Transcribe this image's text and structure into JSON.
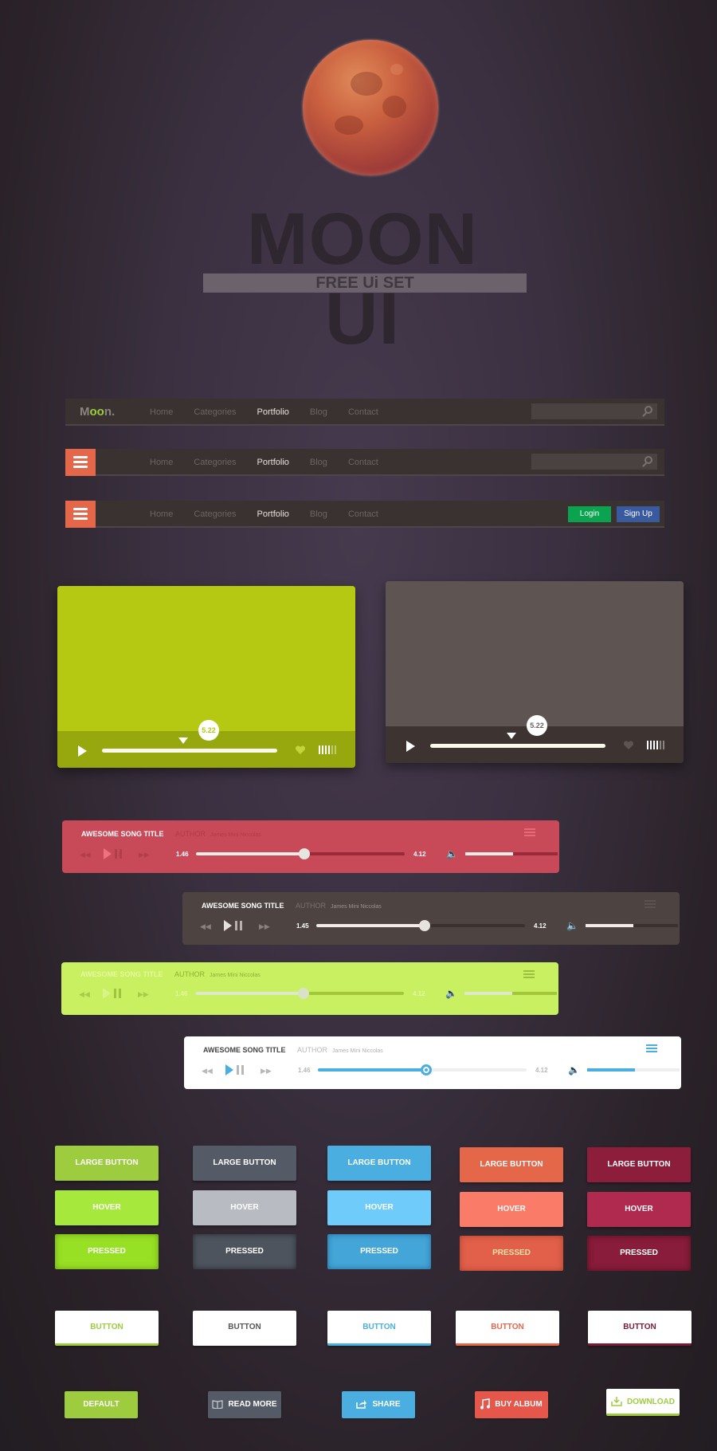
{
  "hero": {
    "title": "MOON UI",
    "subtitle": "FREE Ui SET"
  },
  "colors": {
    "green": "#9ccf3a",
    "lime_video": "#b5c912",
    "coral": "#e5674a",
    "crimson": "#8c1e3c",
    "blue": "#4aafe0",
    "slate": "#555b66",
    "login_green": "#0aa451",
    "signup_blue": "#3a5aa0"
  },
  "navbars": [
    {
      "variant": "logo-search",
      "logo": {
        "prefix": "M",
        "highlight": "oo",
        "suffix": "n."
      },
      "items": [
        "Home",
        "Categories",
        "Portfolio",
        "Blog",
        "Contact"
      ],
      "active": "Portfolio",
      "search_placeholder": ""
    },
    {
      "variant": "menu-search",
      "items": [
        "Home",
        "Categories",
        "Portfolio",
        "Blog",
        "Contact"
      ],
      "active": "Portfolio",
      "search_placeholder": ""
    },
    {
      "variant": "menu-auth",
      "items": [
        "Home",
        "Categories",
        "Portfolio",
        "Blog",
        "Contact"
      ],
      "active": "Portfolio",
      "login_label": "Login",
      "signup_label": "Sign Up"
    }
  ],
  "video_players": [
    {
      "theme": "lime",
      "time_bubble": "5.22",
      "progress_pct": 47
    },
    {
      "theme": "dark",
      "time_bubble": "5.22",
      "progress_pct": 47
    }
  ],
  "audio_players": [
    {
      "theme": "red",
      "title": "AWESOME SONG TITLE",
      "author_label": "AUTHOR",
      "author_name": "James Mini Niccolas",
      "current": "1.46",
      "duration": "4.12",
      "progress_pct": 52,
      "volume_pct": 52
    },
    {
      "theme": "dark",
      "title": "AWESOME SONG TITLE",
      "author_label": "AUTHOR",
      "author_name": "James Mini Niccolas",
      "current": "1.45",
      "duration": "4.12",
      "progress_pct": 52,
      "volume_pct": 52
    },
    {
      "theme": "lime",
      "title": "AWESOME SONG TITLE",
      "author_label": "AUTHOR",
      "author_name": "James Mini Niccolas",
      "current": "1.46",
      "duration": "4.12",
      "progress_pct": 52,
      "volume_pct": 52
    },
    {
      "theme": "white",
      "title": "AWESOME SONG TITLE",
      "author_label": "AUTHOR",
      "author_name": "James Mini Niccolas",
      "current": "1.46",
      "duration": "4.12",
      "progress_pct": 52,
      "volume_pct": 52
    }
  ],
  "button_grid": {
    "columns": [
      {
        "color": "green",
        "normal": "LARGE BUTTON",
        "hover": "HOVER",
        "pressed": "PRESSED"
      },
      {
        "color": "slate",
        "normal": "LARGE BUTTON",
        "hover": "HOVER",
        "pressed": "PRESSED"
      },
      {
        "color": "blue",
        "normal": "LARGE BUTTON",
        "hover": "HOVER",
        "pressed": "PRESSED"
      },
      {
        "color": "coral",
        "normal": "LARGE BUTTON",
        "hover": "HOVER",
        "pressed": "PRESSED"
      },
      {
        "color": "crimson",
        "normal": "LARGE BUTTON",
        "hover": "HOVER",
        "pressed": "PRESSED"
      }
    ]
  },
  "white_buttons": [
    "BUTTON",
    "BUTTON",
    "BUTTON",
    "BUTTON",
    "BUTTON"
  ],
  "icon_buttons": [
    {
      "label": "DEFAULT",
      "icon": ""
    },
    {
      "label": "READ MORE",
      "icon": "book-icon"
    },
    {
      "label": "SHARE",
      "icon": "share-icon"
    },
    {
      "label": "BUY ALBUM",
      "icon": "music-note-icon"
    },
    {
      "label": "DOWNLOAD",
      "icon": "download-icon"
    }
  ]
}
